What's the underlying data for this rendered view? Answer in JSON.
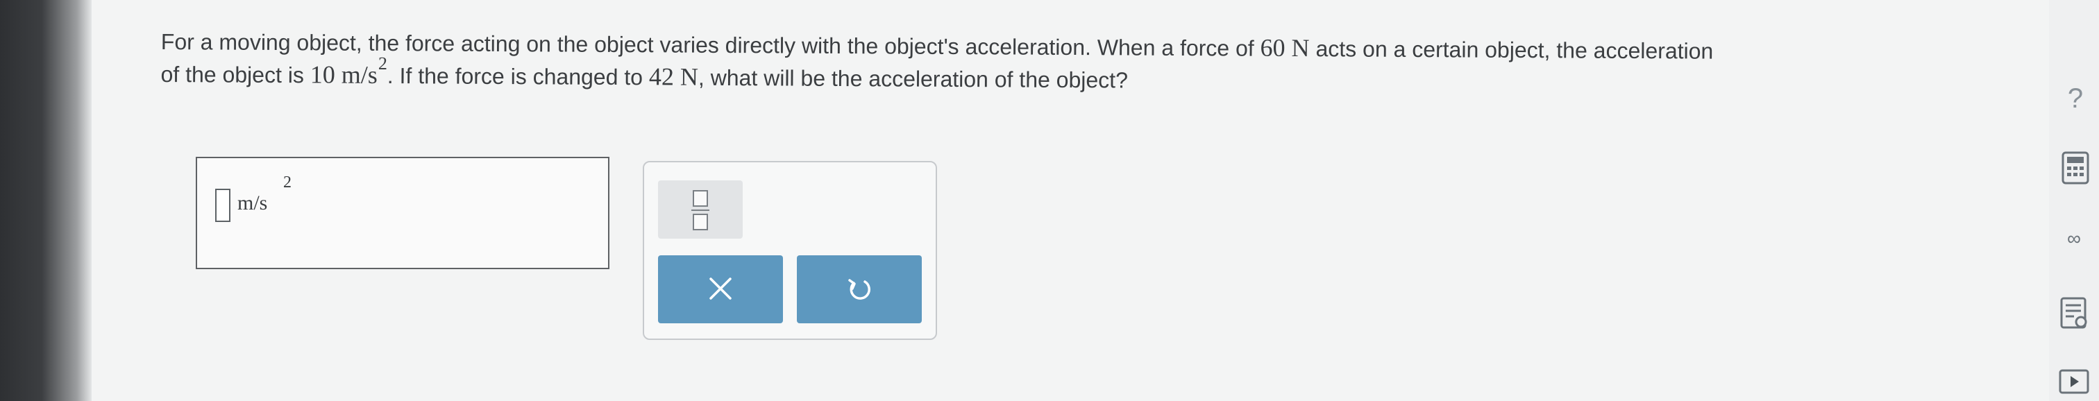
{
  "question": {
    "line1": "For a moving object, the force acting on the object varies directly with the object's acceleration. When a force of",
    "force1": "60 N",
    "line1_end": "acts on a certain object, the acceleration",
    "line2_start": "of the object is",
    "accel_value": "10 m/s",
    "accel_exp": "2",
    "line2_mid": ". If the force is changed to",
    "force2": "42 N",
    "line2_end": ", what will be the acceleration of the object?"
  },
  "answer": {
    "unit": "m/s",
    "unit_exponent": "2"
  },
  "tools": {
    "fraction": "fraction-icon",
    "clear": "close-icon",
    "undo": "undo-icon"
  },
  "toolbar": {
    "help_label": "?",
    "calculator": "calculator-icon",
    "periodic_table": "infinity-icon",
    "data": "data-icon",
    "video": "play-icon"
  },
  "colors": {
    "button_blue": "#5d98bf",
    "text": "#3b3e41",
    "background": "#f3f4f4"
  }
}
